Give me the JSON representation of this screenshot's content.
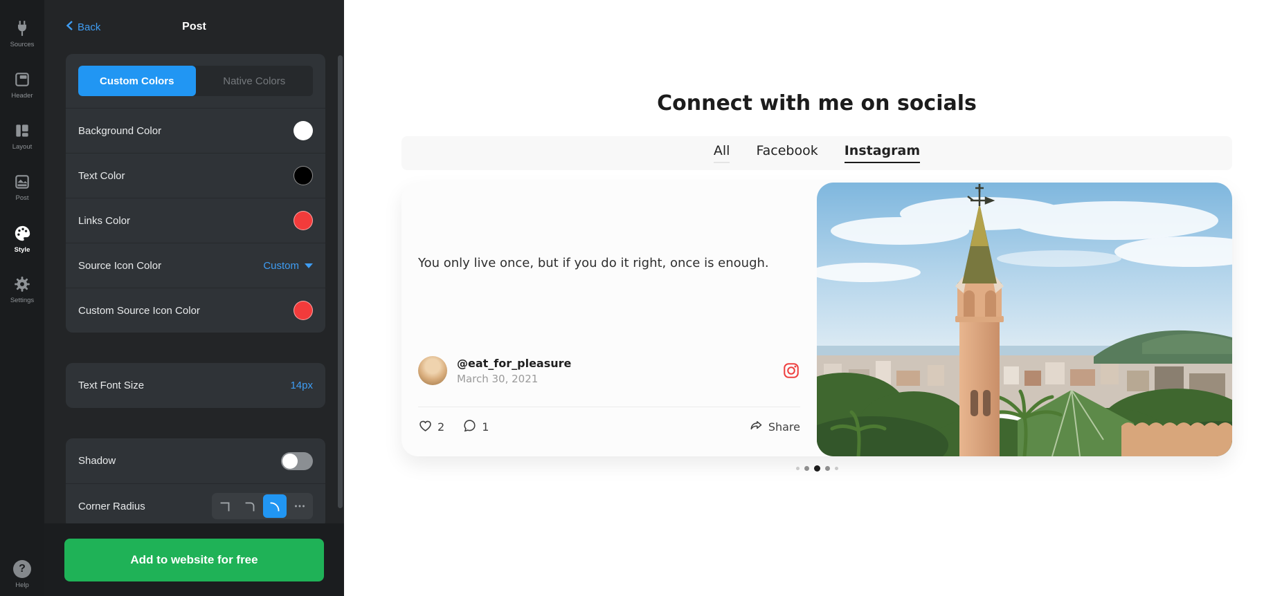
{
  "sidebar": {
    "items": [
      {
        "label": "Sources",
        "icon": "plug-icon",
        "active": false
      },
      {
        "label": "Header",
        "icon": "header-icon",
        "active": false
      },
      {
        "label": "Layout",
        "icon": "layout-icon",
        "active": false
      },
      {
        "label": "Post",
        "icon": "image-icon",
        "active": false
      },
      {
        "label": "Style",
        "icon": "palette-icon",
        "active": true
      },
      {
        "label": "Settings",
        "icon": "gear-icon",
        "active": false
      }
    ],
    "help": {
      "label": "Help",
      "icon": "question-icon",
      "glyph": "?"
    }
  },
  "panel": {
    "back_label": "Back",
    "title": "Post",
    "color_mode": {
      "options": [
        "Custom Colors",
        "Native Colors"
      ],
      "selected": "Custom Colors"
    },
    "rows": {
      "background_color": {
        "label": "Background Color",
        "swatch": "#ffffff"
      },
      "text_color": {
        "label": "Text Color",
        "swatch": "#000000"
      },
      "links_color": {
        "label": "Links Color",
        "swatch": "#f23b3b"
      },
      "source_icon_color": {
        "label": "Source Icon Color",
        "value": "Custom"
      },
      "custom_source_icon_color": {
        "label": "Custom Source Icon Color",
        "swatch": "#f23b3b"
      },
      "text_font_size": {
        "label": "Text Font Size",
        "value": "14px"
      },
      "shadow": {
        "label": "Shadow",
        "enabled": false
      },
      "corner_radius": {
        "label": "Corner Radius",
        "selected": "rounded"
      }
    },
    "cta_label": "Add to website for free"
  },
  "widget": {
    "title": "Connect with me on socials",
    "tabs": [
      {
        "label": "All",
        "active": false
      },
      {
        "label": "Facebook",
        "active": false
      },
      {
        "label": "Instagram",
        "active": true
      }
    ],
    "post": {
      "text": "You only live once, but if you do it right, once is enough.",
      "author_handle": "@eat_for_pleasure",
      "date": "March 30, 2021",
      "source": "instagram",
      "likes": "2",
      "comments": "1",
      "share_label": "Share"
    },
    "pagination": {
      "total": 5,
      "active_index": 2
    }
  },
  "colors": {
    "accent_blue": "#2196f3",
    "link_blue": "#3f9df3",
    "cta_green": "#1fb257",
    "swatch_red": "#f23b3b",
    "instagram_red": "#ee4040",
    "panel_bg": "#232527",
    "rail_bg": "#1a1c1e",
    "card_bg": "#2f3337"
  }
}
